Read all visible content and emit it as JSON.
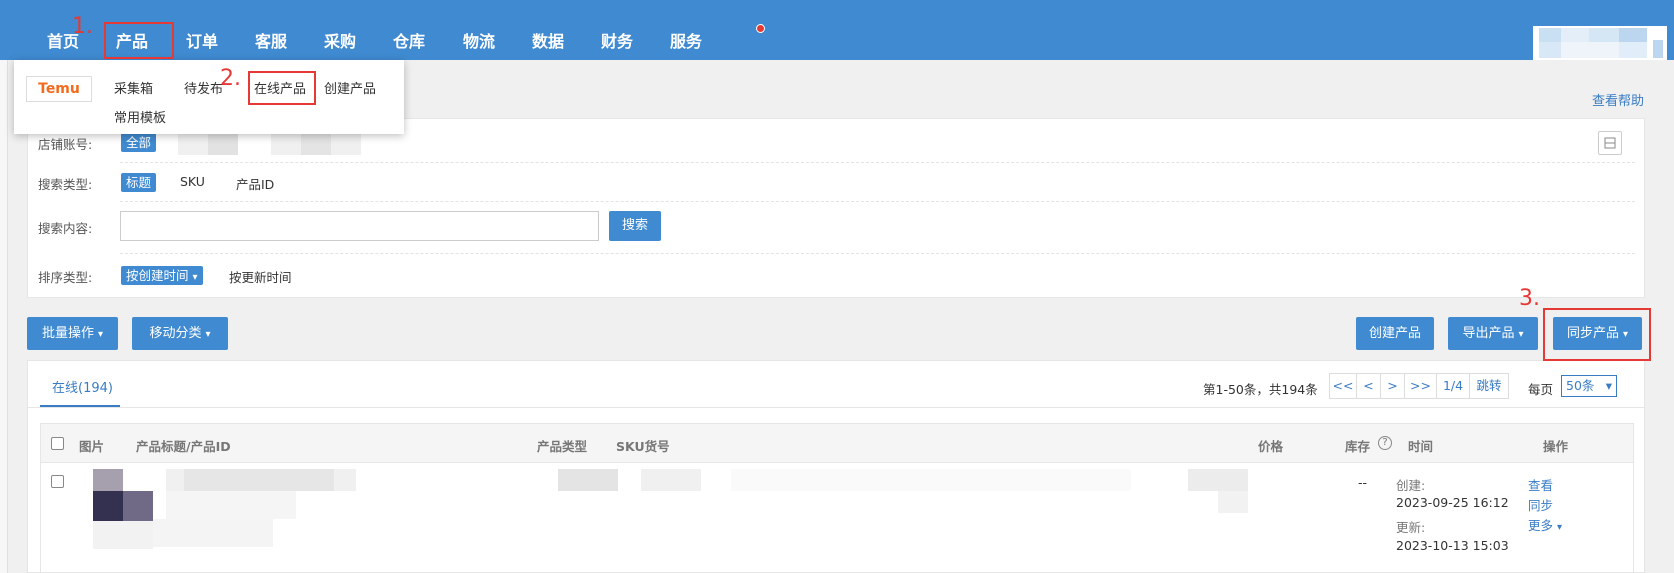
{
  "nav": {
    "items": [
      "首页",
      "产品",
      "订单",
      "客服",
      "采购",
      "仓库",
      "物流",
      "数据",
      "财务",
      "服务"
    ]
  },
  "dropdown": {
    "logo": "Temu",
    "items": [
      "采集箱",
      "待发布",
      "在线产品",
      "创建产品",
      "常用模板"
    ]
  },
  "annotations": [
    "1.",
    "2.",
    "3."
  ],
  "help_link": "查看帮助",
  "filter": {
    "shop_label": "店铺账号:",
    "shop_tag": "全部",
    "search_type_label": "搜索类型:",
    "search_type_tag": "标题",
    "search_type_options": [
      "SKU",
      "产品ID"
    ],
    "search_content_label": "搜索内容:",
    "search_placeholder": "",
    "search_button": "搜索",
    "sort_label": "排序类型:",
    "sort_tag": "按创建时间",
    "sort_option": "按更新时间"
  },
  "actions": {
    "batch": "批量操作",
    "move_category": "移动分类",
    "create_product": "创建产品",
    "export_product": "导出产品",
    "sync_product": "同步产品"
  },
  "table": {
    "tab_online": "在线(194)",
    "page_info": "第1-50条，共194条",
    "pager": [
      "<<",
      "<",
      ">",
      ">>",
      "1/4",
      "跳转"
    ],
    "per_page_label": "每页",
    "per_page_value": "50条",
    "headers": {
      "image": "图片",
      "title": "产品标题/产品ID",
      "type": "产品类型",
      "sku": "SKU货号",
      "price": "价格",
      "stock": "库存",
      "time": "时间",
      "ops": "操作"
    },
    "rows": [
      {
        "stock": "--",
        "created_label": "创建:",
        "created": "2023-09-25 16:12",
        "updated_label": "更新:",
        "updated": "2023-10-13 15:03",
        "ops": [
          "查看",
          "同步",
          "更多"
        ]
      }
    ]
  },
  "colors": {
    "nav_bg": "#3f8ad0",
    "accent": "#3a7cc4",
    "annotation": "#e53935",
    "temu_orange": "#f26b1d"
  }
}
